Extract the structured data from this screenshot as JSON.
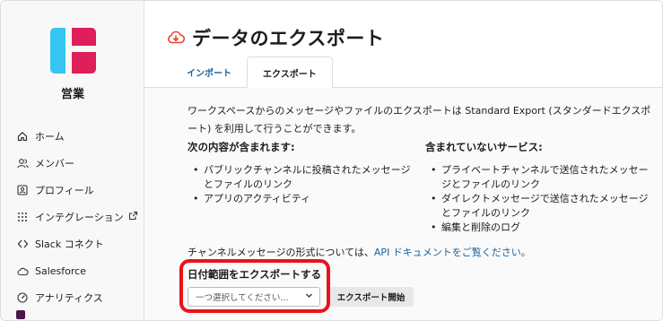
{
  "workspace": {
    "name": "営業"
  },
  "sidebar": {
    "items": [
      {
        "label": "ホーム",
        "icon": "home-icon"
      },
      {
        "label": "メンバー",
        "icon": "members-icon"
      },
      {
        "label": "プロフィール",
        "icon": "profile-icon"
      },
      {
        "label": "インテグレーション",
        "icon": "integrations-icon",
        "external": true
      },
      {
        "label": "Slack コネクト",
        "icon": "slack-connect-icon"
      },
      {
        "label": "Salesforce",
        "icon": "cloud-icon"
      },
      {
        "label": "アナリティクス",
        "icon": "analytics-icon"
      }
    ]
  },
  "header": {
    "title": "データのエクスポート",
    "icon": "cloud-download-icon"
  },
  "tabs": [
    {
      "label": "インポート",
      "active": false
    },
    {
      "label": "エクスポート",
      "active": true
    }
  ],
  "content": {
    "intro": "ワークスペースからのメッセージやファイルのエクスポートは Standard Export (スタンダードエクスポート) を利用して行うことができます。",
    "included": {
      "heading": "次の内容が含まれます:",
      "items": [
        "パブリックチャンネルに投稿されたメッセージとファイルのリンク",
        "アプリのアクティビティ"
      ]
    },
    "excluded": {
      "heading": "含まれていないサービス:",
      "items": [
        "プライベートチャンネルで送信されたメッセージとファイルのリンク",
        "ダイレクトメッセージで送信されたメッセージとファイルのリンク",
        "編集と削除のログ"
      ]
    },
    "format_note_prefix": "チャンネルメッセージの形式については、",
    "format_note_link": "API ドキュメントをご覧ください。",
    "range_label": "日付範囲をエクスポートする",
    "select_placeholder": "一つ選択してください...",
    "export_button": "エクスポート開始"
  },
  "colors": {
    "accent_link": "#1264a3",
    "highlight": "#e8141b",
    "logo_blue": "#36c5f0",
    "logo_red": "#e01e5a",
    "title_icon": "#e8432e"
  }
}
